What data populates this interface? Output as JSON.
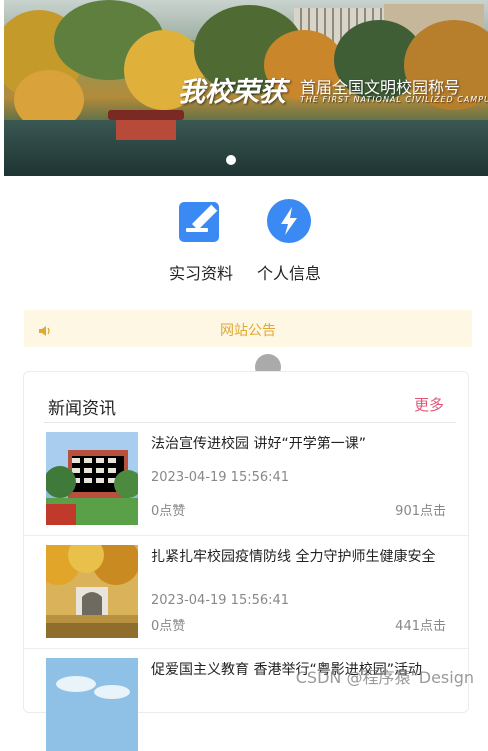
{
  "banner": {
    "title": "我校荣获",
    "subtitle": "首届全国文明校园称号",
    "subtitle_en": "THE FIRST NATIONAL CIVILIZED CAMPUS"
  },
  "quick_links": [
    {
      "label": "实习资料",
      "icon": "edit-document-icon",
      "color": "#3b8af3"
    },
    {
      "label": "个人信息",
      "icon": "lightning-icon",
      "color": "#3b8af3"
    }
  ],
  "notice": {
    "label": "网站公告",
    "icon": "speaker-icon",
    "color": "#e0a935"
  },
  "news": {
    "title": "新闻资讯",
    "more": "更多",
    "items": [
      {
        "title": "法治宣传进校园 讲好“开学第一课”",
        "date": "2023-04-19 15:56:41",
        "likes": "0点赞",
        "clicks": "901点击"
      },
      {
        "title": "扎紧扎牢校园疫情防线 全力守护师生健康安全",
        "date": "2023-04-19 15:56:41",
        "likes": "0点赞",
        "clicks": "441点击"
      },
      {
        "title": "促爱国主义教育 香港举行“粤影进校园”活动",
        "date": "",
        "likes": "",
        "clicks": ""
      }
    ]
  },
  "watermark": "CSDN @程序猿“Design"
}
